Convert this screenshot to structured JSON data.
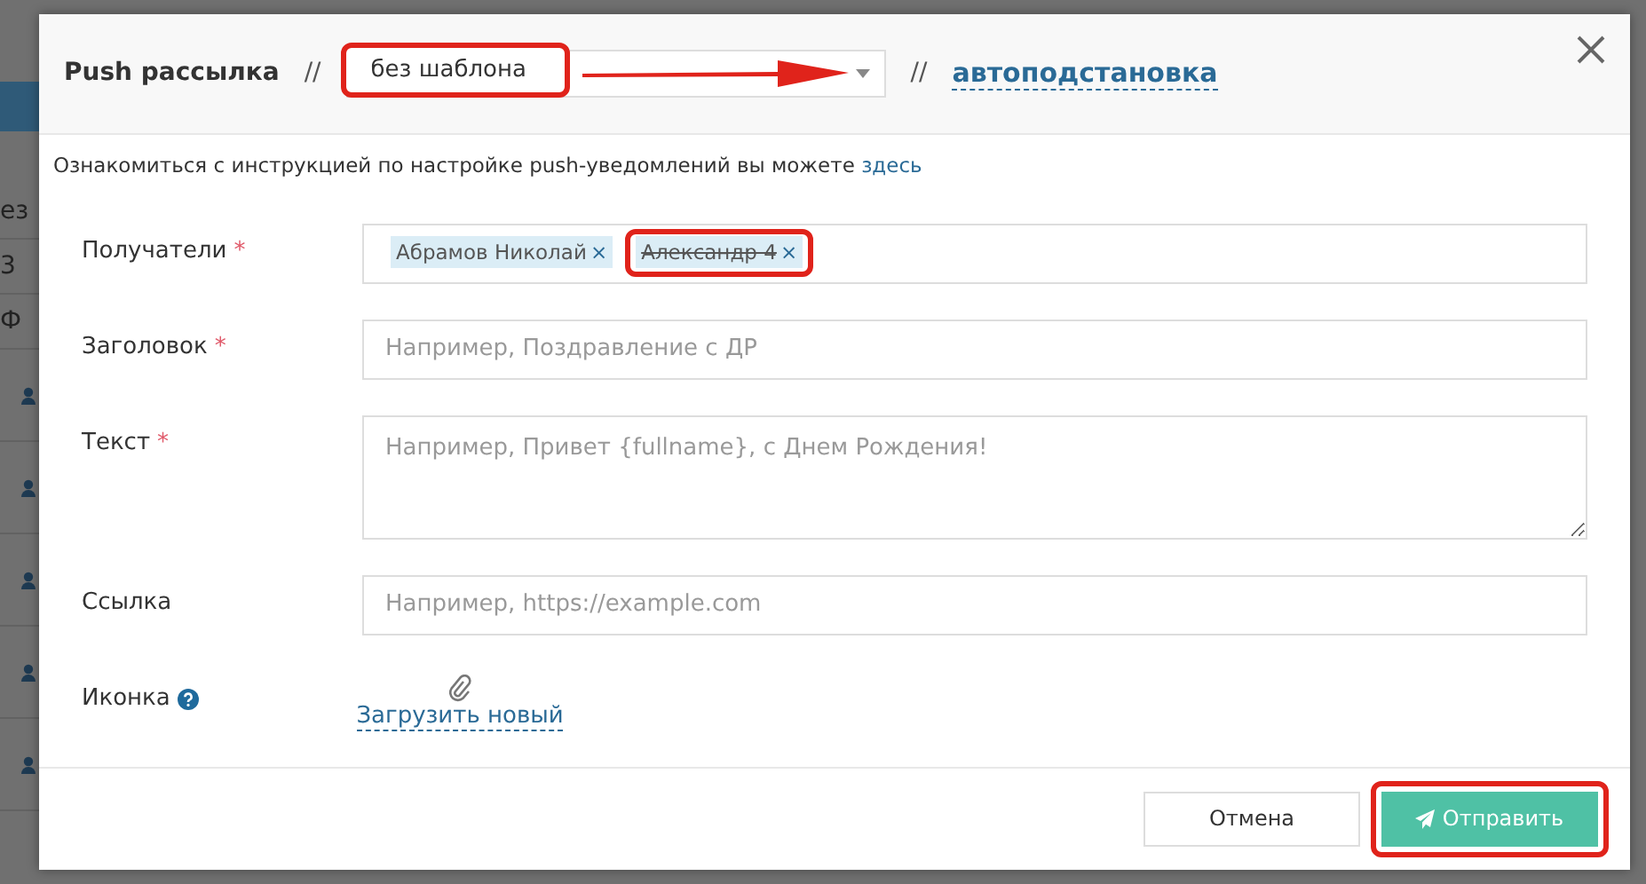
{
  "backdrop": {
    "fragments": [
      "ез",
      "3",
      "Ф"
    ]
  },
  "dialog": {
    "title": "Push рассылка",
    "separator": "//",
    "template_select": {
      "value": "без шаблона",
      "highlighted": true
    },
    "separator_2": "//",
    "autofill_link": "автоподстановка",
    "info": {
      "text": "Ознакомиться с инструкцией по настройке push-уведомлений вы можете",
      "link": "здесь"
    },
    "fields": [
      {
        "kind": "tags",
        "label": "Получатели",
        "required_mark": "*",
        "tags": [
          {
            "text": "Абрамов Николай",
            "remove": "×",
            "struck": false,
            "highlighted": false
          },
          {
            "text": "Александр 4",
            "remove": "×",
            "struck": true,
            "highlighted": true
          }
        ]
      },
      {
        "kind": "input",
        "label": "Заголовок",
        "required_mark": "*",
        "placeholder": "Например, Поздравление с ДР"
      },
      {
        "kind": "textarea",
        "label": "Текст",
        "required_mark": "*",
        "placeholder": "Например, Привет {fullname}, с Днем Рождения!"
      },
      {
        "kind": "input",
        "label": "Ссылка",
        "placeholder": "Например, https://example.com"
      },
      {
        "kind": "upload",
        "label": "Иконка",
        "help": true,
        "link": "Загрузить новый"
      }
    ],
    "buttons": [
      {
        "kind": "cancel",
        "label": "Отмена",
        "highlighted": false
      },
      {
        "kind": "send",
        "label": "Отправить",
        "highlighted": true
      }
    ]
  }
}
